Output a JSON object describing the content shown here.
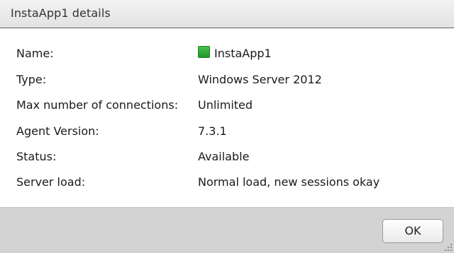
{
  "dialog": {
    "title": "InstaApp1 details"
  },
  "details": [
    {
      "label": "Name:",
      "value": "InstaApp1"
    },
    {
      "label": "Type:",
      "value": "Windows Server 2012"
    },
    {
      "label": "Max number of connections:",
      "value": "Unlimited"
    },
    {
      "label": "Agent Version:",
      "value": "7.3.1"
    },
    {
      "label": "Status:",
      "value": "Available"
    },
    {
      "label": "Server load:",
      "value": "Normal load, new sessions okay"
    }
  ],
  "status_indicator": {
    "icon": "green-status-square",
    "color": "#2fa834"
  },
  "footer": {
    "ok_label": "OK"
  }
}
